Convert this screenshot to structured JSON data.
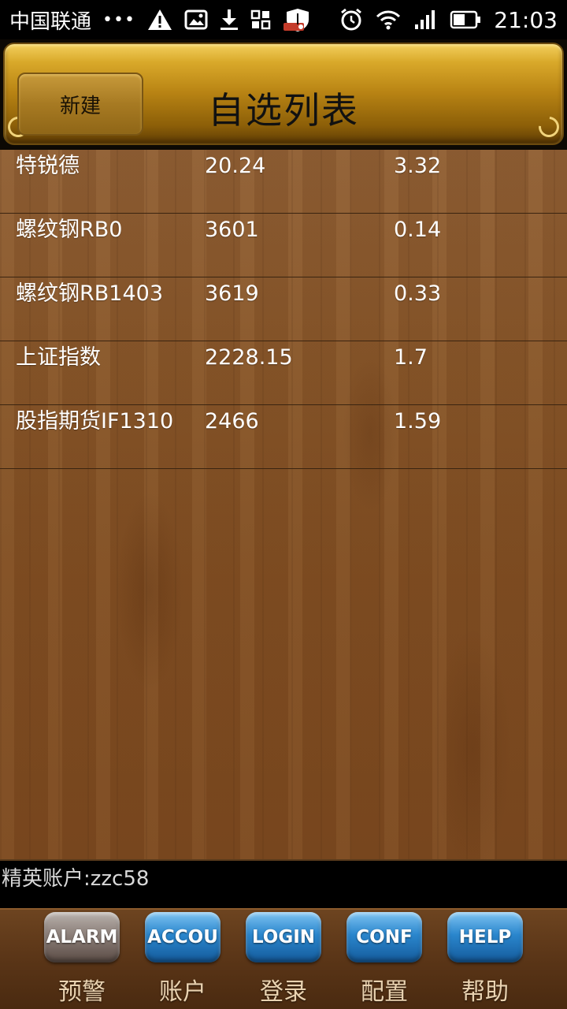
{
  "status_bar": {
    "carrier": "中国联通",
    "more": "•••",
    "time": "21:03",
    "icons": [
      "warning-icon",
      "image-icon",
      "download-icon",
      "app-grid-icon",
      "shield-icon",
      "alarm-icon",
      "wifi-icon",
      "signal-icon",
      "battery-icon"
    ]
  },
  "header": {
    "new_button_label": "新建",
    "title": "自选列表"
  },
  "watchlist": [
    {
      "name": "特锐德",
      "price": "20.24",
      "change": "3.32"
    },
    {
      "name": "螺纹钢RB0",
      "price": "3601",
      "change": "0.14"
    },
    {
      "name": "螺纹钢RB1403",
      "price": "3619",
      "change": "0.33"
    },
    {
      "name": "上证指数",
      "price": "2228.15",
      "change": "1.7"
    },
    {
      "name": "股指期货IF1310",
      "price": "2466",
      "change": "1.59"
    }
  ],
  "account": {
    "label": "精英账户:zzc58"
  },
  "bottom_nav": [
    {
      "badge": "ALARM",
      "label": "预警",
      "color": "#8c7f79"
    },
    {
      "badge": "ACCOU",
      "label": "账户",
      "color": "#2a86cd"
    },
    {
      "badge": "LOGIN",
      "label": "登录",
      "color": "#2a86cd"
    },
    {
      "badge": "CONF",
      "label": "配置",
      "color": "#2a86cd"
    },
    {
      "badge": "HELP",
      "label": "帮助",
      "color": "#2a86cd"
    }
  ]
}
